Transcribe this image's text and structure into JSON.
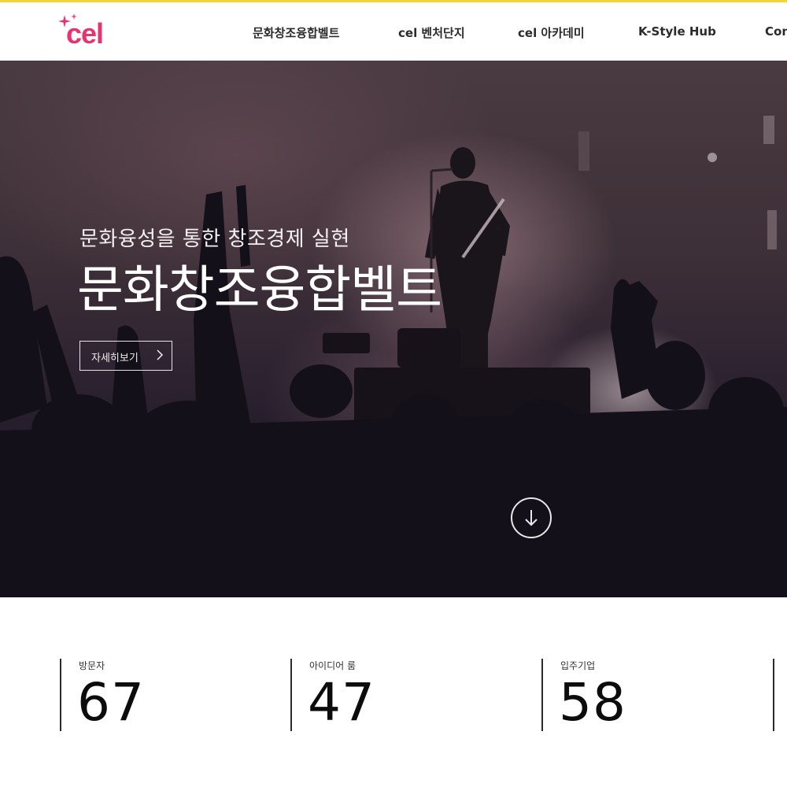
{
  "brand": {
    "logo_text": "cel",
    "accent": "#e8336e",
    "top_line": "#f0d43a"
  },
  "nav": {
    "items": [
      {
        "label": "문화창조융합벨트"
      },
      {
        "label": "cel 벤처단지"
      },
      {
        "label": "cel 아카데미"
      },
      {
        "label": "K-Style Hub"
      },
      {
        "label": "Con"
      }
    ]
  },
  "hero": {
    "subtitle": "문화융성을 통한 창조경제 실현",
    "title": "문화창조융합벨트",
    "button_label": "자세히보기",
    "button_icon": "chevron-right-icon",
    "scroll_icon": "arrow-down-icon"
  },
  "stats": [
    {
      "label": "방문자",
      "value": "67"
    },
    {
      "label": "아이디어 룸",
      "value": "47"
    },
    {
      "label": "입주기업",
      "value": "58"
    }
  ]
}
